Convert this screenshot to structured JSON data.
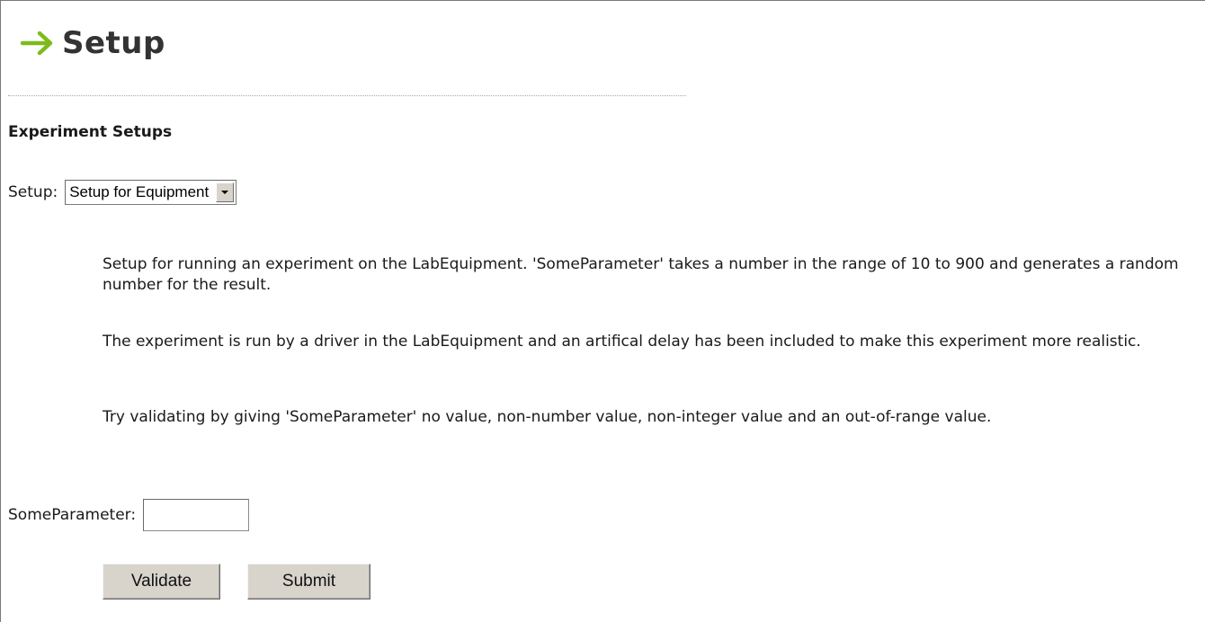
{
  "header": {
    "title": "Setup",
    "icon": "right-arrow-icon",
    "icon_color": "#7dbb1c"
  },
  "section": {
    "heading": "Experiment Setups"
  },
  "setup": {
    "label": "Setup:",
    "selected": "Setup for Equipment"
  },
  "description": {
    "paragraphs": [
      "Setup for running an experiment on the LabEquipment. 'SomeParameter' takes a number in the range of 10 to 900 and generates a random number for the result.",
      "The experiment is run by a driver in the LabEquipment and an artifical delay has been included to make this experiment more realistic.",
      "Try validating by giving 'SomeParameter' no value, non-number value, non-integer value and an out-of-range value."
    ]
  },
  "parameter": {
    "label": "SomeParameter:",
    "value": ""
  },
  "buttons": {
    "validate": "Validate",
    "submit": "Submit"
  }
}
